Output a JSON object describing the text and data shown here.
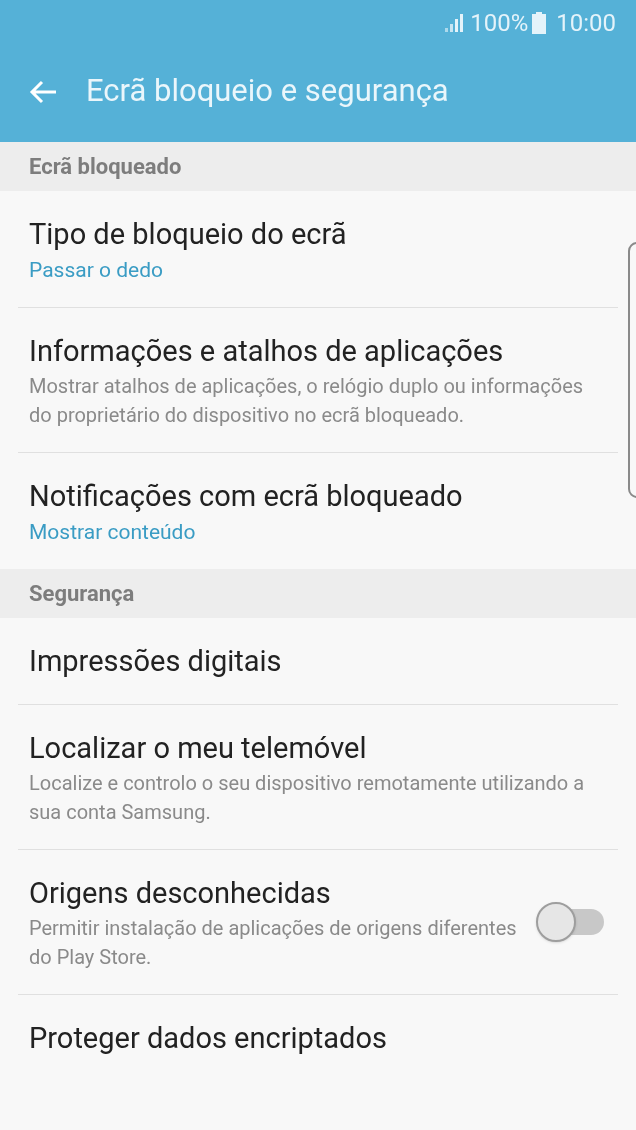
{
  "status_bar": {
    "battery": "100%",
    "time": "10:00"
  },
  "app_bar": {
    "title": "Ecrã bloqueio e segurança"
  },
  "sections": [
    {
      "header": "Ecrã bloqueado",
      "items": [
        {
          "kind": "value",
          "title": "Tipo de bloqueio do ecrã",
          "subtitle": "Passar o dedo"
        },
        {
          "kind": "description",
          "title": "Informações e atalhos de aplicações",
          "subtitle": "Mostrar atalhos de aplicações, o relógio duplo ou informações do proprietário do dispositivo no ecrã bloqueado."
        },
        {
          "kind": "value",
          "title": "Notificações com ecrã bloqueado",
          "subtitle": "Mostrar conteúdo"
        }
      ]
    },
    {
      "header": "Segurança",
      "items": [
        {
          "kind": "plain",
          "title": "Impressões digitais"
        },
        {
          "kind": "description",
          "title": "Localizar o meu telemóvel",
          "subtitle": "Localize e controlo o seu dispositivo remotamente utilizando a sua conta Samsung."
        },
        {
          "kind": "description",
          "title": "Origens desconhecidas",
          "subtitle": "Permitir instalação de aplicações de origens diferentes do Play Store.",
          "switch": {
            "on": false
          }
        },
        {
          "kind": "plain",
          "title": "Proteger dados encriptados"
        }
      ]
    }
  ]
}
